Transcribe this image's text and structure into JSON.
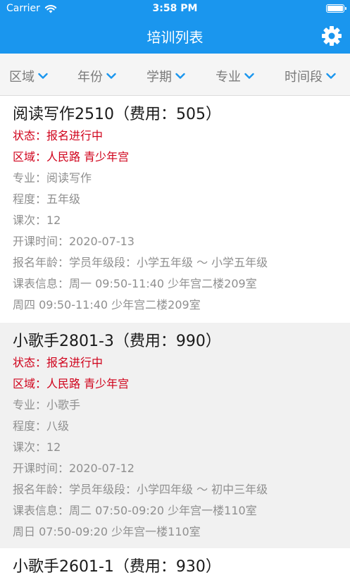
{
  "status_bar": {
    "carrier": "Carrier",
    "time": "3:58 PM"
  },
  "nav": {
    "title": "培训列表"
  },
  "filters": [
    {
      "label": "区域"
    },
    {
      "label": "年份"
    },
    {
      "label": "学期"
    },
    {
      "label": "专业"
    },
    {
      "label": "时间段"
    }
  ],
  "courses": [
    {
      "title": "阅读写作2510（费用：505）",
      "status": "状态：报名进行中",
      "area": "区域：人民路 青少年宫",
      "major": "专业：阅读写作",
      "level": "程度：五年级",
      "sessions": "课次：12",
      "start": "开课时间：2020-07-13",
      "age": "报名年龄：学员年级段：小学五年级 ～ 小学五年级",
      "schedule": "课表信息：周一 09:50-11:40 少年宫二楼209室",
      "schedule2": "周四 09:50-11:40 少年宫二楼209室"
    },
    {
      "title": "小歌手2801-3（费用：990）",
      "status": "状态：报名进行中",
      "area": "区域：人民路 青少年宫",
      "major": "专业：小歌手",
      "level": "程度：八级",
      "sessions": "课次：12",
      "start": "开课时间：2020-07-12",
      "age": "报名年龄：学员年级段：小学四年级 ～ 初中三年级",
      "schedule": "课表信息：周二 07:50-09:20 少年宫一楼110室",
      "schedule2": "周日 07:50-09:20 少年宫一楼110室"
    },
    {
      "title": "小歌手2601-1（费用：930）"
    }
  ],
  "colors": {
    "header": "#1a96ee",
    "status_red": "#d0021b",
    "filter_text": "#7a7a7a",
    "detail_text": "#8f8f8f"
  }
}
